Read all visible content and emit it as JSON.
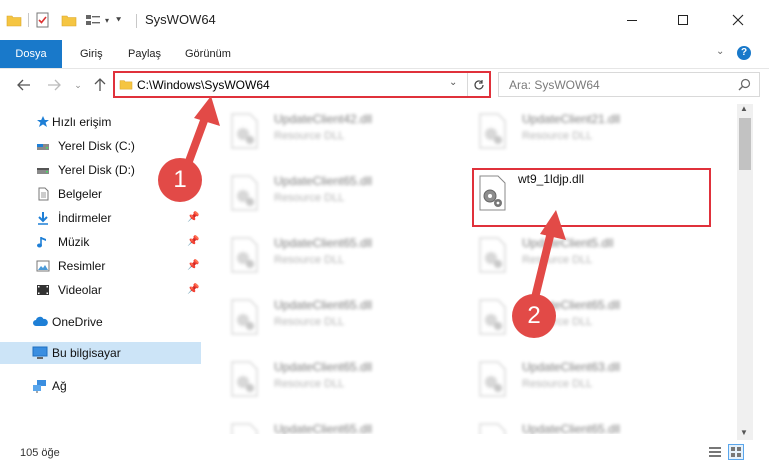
{
  "window": {
    "title": "SysWOW64",
    "controls": [
      "minimize",
      "maximize",
      "close"
    ]
  },
  "ribbon": {
    "tabs": [
      {
        "label": "Dosya"
      },
      {
        "label": "Giriş"
      },
      {
        "label": "Paylaş"
      },
      {
        "label": "Görünüm"
      }
    ],
    "help_label": "?"
  },
  "address": {
    "path": "C:\\Windows\\SysWOW64"
  },
  "search": {
    "placeholder": "Ara: SysWOW64"
  },
  "sidebar": {
    "items": [
      {
        "label": "Hızlı erişim",
        "icon": "star-icon"
      },
      {
        "label": "Yerel Disk (C:)",
        "icon": "drive-icon"
      },
      {
        "label": "Yerel Disk (D:)",
        "icon": "drive-icon"
      },
      {
        "label": "Belgeler",
        "icon": "document-icon"
      },
      {
        "label": "İndirmeler",
        "icon": "download-icon",
        "pinned": true
      },
      {
        "label": "Müzik",
        "icon": "music-icon",
        "pinned": true
      },
      {
        "label": "Resimler",
        "icon": "pictures-icon",
        "pinned": true
      },
      {
        "label": "Videolar",
        "icon": "video-icon",
        "pinned": true
      },
      {
        "label": "OneDrive",
        "icon": "cloud-icon"
      },
      {
        "label": "Bu bilgisayar",
        "icon": "computer-icon",
        "selected": true
      },
      {
        "label": "Ağ",
        "icon": "network-icon"
      }
    ]
  },
  "files": [
    {
      "name": "UpdateClient42.dll",
      "type": "Resource DLL"
    },
    {
      "name": "UpdateClient21.dll",
      "type": "Resource DLL"
    },
    {
      "name": "UpdateClient65.dll",
      "type": "Resource DLL"
    },
    {
      "name": "wt9_1ldjp.dll",
      "type": ""
    },
    {
      "name": "UpdateClient65.dll",
      "type": "Resource DLL"
    },
    {
      "name": "UpdateClient5.dll",
      "type": "Resource DLL"
    },
    {
      "name": "UpdateClient65.dll",
      "type": "Resource DLL"
    },
    {
      "name": "UpdateClient65.dll",
      "type": "Resource DLL"
    },
    {
      "name": "UpdateClient65.dll",
      "type": "Resource DLL"
    },
    {
      "name": "UpdateClient63.dll",
      "type": "Resource DLL"
    },
    {
      "name": "UpdateClient65.dll",
      "type": "Resource DLL"
    },
    {
      "name": "UpdateClient65.dll",
      "type": "Resource DLL"
    }
  ],
  "status": {
    "item_count": "105 öğe"
  },
  "annotations": {
    "step1": "1",
    "step2": "2"
  },
  "colors": {
    "accent": "#1979ca",
    "highlight": "#e0313b",
    "selected": "#cce4f7"
  }
}
